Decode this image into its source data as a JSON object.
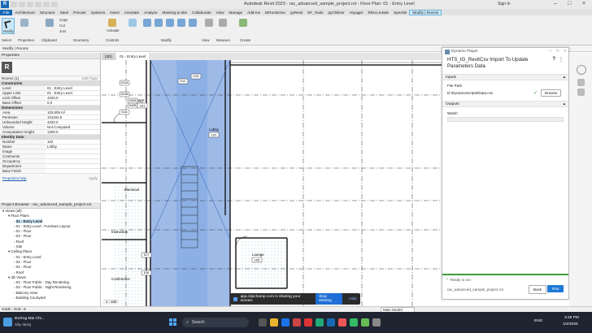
{
  "window": {
    "title": "Autodesk Revit 2023 - rac_advanced_sample_project.rvt - Floor Plan: 01 - Entry Level",
    "signin": "Sign In"
  },
  "tabs": [
    "File",
    "Architecture",
    "Structure",
    "Steel",
    "Precast",
    "Systems",
    "Insert",
    "Annotate",
    "Analyze",
    "Massing & Site",
    "Collaborate",
    "View",
    "Manage",
    "Add-Ins",
    "DiRootsOne",
    "pyRevit",
    "EF_Tools",
    "pyChilizer",
    "Voyager",
    "Rhino.Inside",
    "Speckle",
    "Modify | Rooms"
  ],
  "ribbon": {
    "modify": "Modify",
    "cope": "Cope",
    "cut": "Cut",
    "join": "Join",
    "activate": "Activate",
    "panels": [
      "Select",
      "Properties",
      "Clipboard",
      "Geometry",
      "Controls",
      "Modify",
      "View",
      "Measure",
      "Create"
    ]
  },
  "modify_bar": "Modify | Rooms",
  "properties": {
    "title": "Properties",
    "type": "Rooms (1)",
    "edit_type": "Edit Type",
    "sections": [
      {
        "name": "Constraints",
        "rows": [
          [
            "Level",
            "01 - Entry Level"
          ],
          [
            "Upper Limit",
            "01 - Entry Level"
          ],
          [
            "Limit Offset",
            "4220.0"
          ],
          [
            "Base Offset",
            "0.0"
          ]
        ]
      },
      {
        "name": "Dimensions",
        "rows": [
          [
            "Area",
            "103.509 m²"
          ],
          [
            "Perimeter",
            "101191.8"
          ],
          [
            "Unbounded Height",
            "4220.0"
          ],
          [
            "Volume",
            "Not Computed"
          ],
          [
            "Computation Height",
            "1200.0"
          ]
        ]
      },
      {
        "name": "Identity Data",
        "rows": [
          [
            "Number",
            "102"
          ],
          [
            "Name",
            "Lobby"
          ],
          [
            "Image",
            ""
          ],
          [
            "Comments",
            ""
          ],
          [
            "Occupancy",
            ""
          ],
          [
            "Department",
            ""
          ],
          [
            "Base Finish",
            ""
          ]
        ]
      }
    ],
    "help": "Properties help",
    "apply": "Apply"
  },
  "browser": {
    "title": "Project Browser - rac_advanced_sample_project.rvt",
    "items": [
      {
        "label": "Views (all)",
        "indent": 0
      },
      {
        "label": "Floor Plans",
        "indent": 1
      },
      {
        "label": "01 - Entry Level",
        "indent": 2,
        "selected": true
      },
      {
        "label": "01 - Entry Level - Furniture Layout",
        "indent": 2
      },
      {
        "label": "02 - Floor",
        "indent": 2
      },
      {
        "label": "03 - Floor",
        "indent": 2
      },
      {
        "label": "Roof",
        "indent": 2
      },
      {
        "label": "Site",
        "indent": 2
      },
      {
        "label": "Ceiling Plans",
        "indent": 1
      },
      {
        "label": "01 - Entry Level",
        "indent": 2
      },
      {
        "label": "02 - Floor",
        "indent": 2
      },
      {
        "label": "03 - Floor",
        "indent": 2
      },
      {
        "label": "Roof",
        "indent": 2
      },
      {
        "label": "3D Views",
        "indent": 1
      },
      {
        "label": "03 - Floor Public - Day Rendering",
        "indent": 2
      },
      {
        "label": "03 - Floor Public - Night Rendering",
        "indent": 2
      },
      {
        "label": "Balcony View",
        "indent": 2
      },
      {
        "label": "Building Courtyard",
        "indent": 2
      }
    ]
  },
  "view_tabs": [
    "{3D}",
    "01 - Entry Level"
  ],
  "rooms": [
    {
      "name": "Vest",
      "number": "101"
    },
    {
      "name": "Lobby",
      "number": "102"
    },
    {
      "name": "Electrical",
      "number": ""
    },
    {
      "name": "Instruction",
      "number": ""
    },
    {
      "name": "Conference",
      "number": ""
    },
    {
      "name": "Lounge",
      "number": "105"
    }
  ],
  "tags": [
    "D41A",
    "D41B",
    "D42A",
    "D42B",
    "D1A",
    "D1C",
    "D1D",
    "D17",
    "D16"
  ],
  "view_scale": "1 : 100",
  "dynamo": {
    "app": "Dynamo Player",
    "script": "HTS_IG_RevitCsv Import To Update Parameters Data",
    "inputs": "Inputs",
    "file_path_label": "File Path",
    "file_path": "D:\\DynamoScripts\\Data.csv",
    "browse": "Browse",
    "outputs": "Outputs",
    "watch": "Watch",
    "status": "Ready to run",
    "file": "rac_advanced_sample_project.rvt",
    "back": "Back",
    "run": "Run"
  },
  "status": {
    "left": "Grids : Grid : 6",
    "right": "Main Model"
  },
  "sharing": {
    "text": "app.clipchamp.com is sharing your screen.",
    "stop": "Stop sharing",
    "hide": "Hide"
  },
  "taskbar": {
    "weather_title": "Đường Mai Chi...",
    "weather_sub": "Xây dựng",
    "search": "Search",
    "lang": "ENG",
    "time": "3:49 PM",
    "date": "1/4/2025"
  },
  "colors": {
    "accent": "#1769b5",
    "selection": "#4e83d6",
    "tag_fill": "#cfe7f2",
    "run": "#1f7ad6",
    "taskbar": "#1f2430"
  }
}
